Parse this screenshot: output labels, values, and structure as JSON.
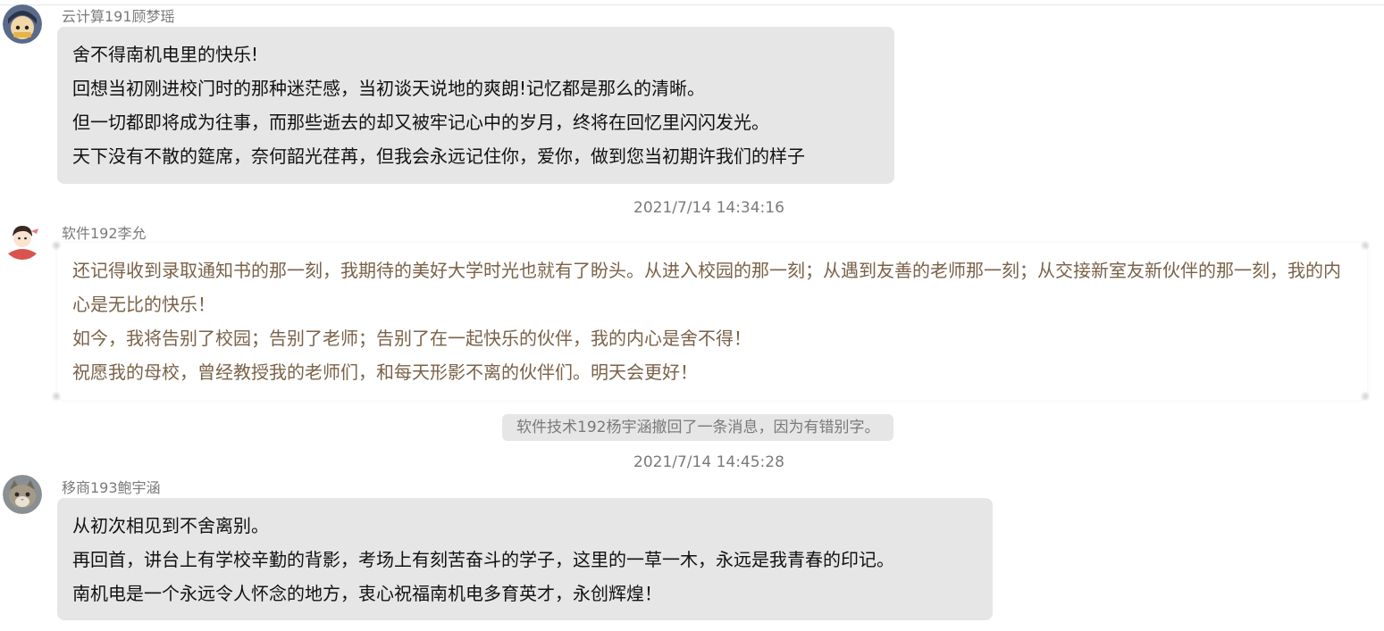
{
  "messages": [
    {
      "sender": "云计算191顾梦瑶",
      "avatar_icon": "cartoon-avatar-icon",
      "lines": [
        "舍不得南机电里的快乐!",
        "回想当初刚进校门时的那种迷茫感，当初谈天说地的爽朗!记忆都是那么的清晰。",
        "但一切都即将成为往事，而那些逝去的却又被牢记心中的岁月，终将在回忆里闪闪发光。",
        "天下没有不散的筵席，奈何韶光荏苒，但我会永远记住你，爱你，做到您当初期许我们的样子"
      ]
    },
    {
      "sender": "软件192李允",
      "avatar_icon": "girl-avatar-icon",
      "lines": [
        "还记得收到录取通知书的那一刻，我期待的美好大学时光也就有了盼头。从进入校园的那一刻；从遇到友善的老师那一刻；从交接新室友新伙伴的那一刻，我的内心是无比的快乐！",
        "如今，我将告别了校园；告别了老师；告别了在一起快乐的伙伴，我的内心是舍不得！",
        "祝愿我的母校，曾经教授我的老师们，和每天形影不离的伙伴们。明天会更好！"
      ]
    },
    {
      "sender": "移商193鲍宇涵",
      "avatar_icon": "cat-avatar-icon",
      "lines": [
        "从初次相见到不舍离别。",
        "再回首，讲台上有学校辛勤的背影，考场上有刻苦奋斗的学子，这里的一草一木，永远是我青春的印记。",
        "南机电是一个永远令人怀念的地方，衷心祝福南机电多育英才，永创辉煌！"
      ]
    }
  ],
  "timestamps": [
    "2021/7/14 14:34:16",
    "2021/7/14 14:45:28"
  ],
  "recall_notice": "软件技术192杨宇涵撤回了一条消息，因为有错别字。"
}
